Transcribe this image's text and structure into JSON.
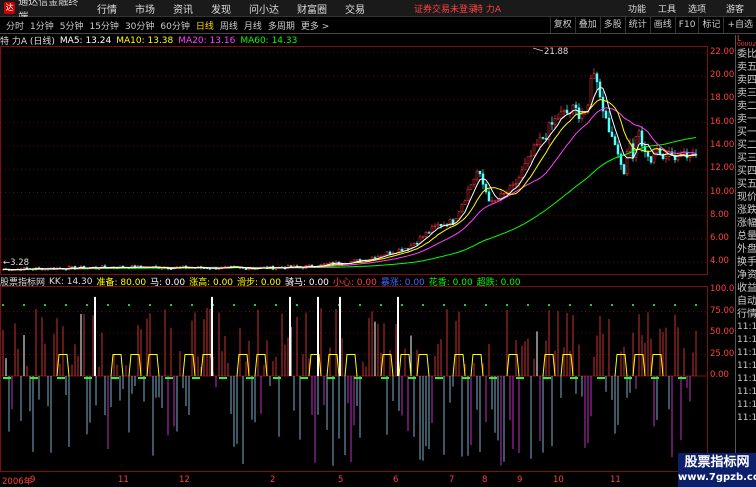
{
  "menubar": {
    "app_title": "通达信金融终端",
    "menu_items": [
      "行情",
      "市场",
      "资讯",
      "发现",
      "问小达",
      "财富圈",
      "交易"
    ],
    "notice": "证券交易未登录",
    "stock_name": "特 力A",
    "right_items": [
      "功能",
      "工具",
      "选项"
    ],
    "guest": "游客"
  },
  "toolbar": {
    "periods": [
      "分时",
      "1分钟",
      "5分钟",
      "15分钟",
      "30分钟",
      "60分钟",
      "日线",
      "周线",
      "月线",
      "多周期",
      "更多 >"
    ],
    "active_period": "日线",
    "tools": [
      "复权",
      "叠加",
      "多股",
      "统计",
      "画线",
      "F10",
      "标记",
      "+自选"
    ]
  },
  "main_header": {
    "title": "特 力A (日线)",
    "ma5": "MA5: 13.24",
    "ma10": "MA10: 13.38",
    "ma20": "MA20: 13.16",
    "ma60": "MA60: 14.33",
    "colors": {
      "ma5": "#ffffff",
      "ma10": "#ffff00",
      "ma20": "#ff40ff",
      "ma60": "#00ff00"
    }
  },
  "price_axis": [
    "22.00",
    "20.00",
    "18.00",
    "16.00",
    "14.00",
    "12.00",
    "10.00",
    "8.00",
    "6.00",
    "4.00"
  ],
  "annotations": {
    "high": "21.88",
    "low": "3.28"
  },
  "indicator_header": {
    "name": "股票指标网",
    "kk": "KK: 14.30",
    "items": [
      {
        "label": "准备:",
        "value": "80.00",
        "color": "#ffff00"
      },
      {
        "label": "马:",
        "value": "0.00",
        "color": "#ffffff"
      },
      {
        "label": "涨高:",
        "value": "0.00",
        "color": "#ffff00"
      },
      {
        "label": "滑步:",
        "value": "0.00",
        "color": "#ffff00"
      },
      {
        "label": "骑马:",
        "value": "0.00",
        "color": "#ffffff"
      },
      {
        "label": "小心:",
        "value": "0.00",
        "color": "#ff4040"
      },
      {
        "label": "暴涨:",
        "value": "0.00",
        "color": "#4466ff"
      },
      {
        "label": "花香:",
        "value": "0.00",
        "color": "#00ff00"
      },
      {
        "label": "超跌:",
        "value": "0.00",
        "color": "#00ff00"
      }
    ]
  },
  "indicator_axis": [
    "100.0",
    "75.00",
    "50.00",
    "25.00",
    "0.00"
  ],
  "dates": [
    "2006年",
    "9",
    "11",
    "12",
    "2",
    "5",
    "6",
    "7",
    "8",
    "9",
    "10",
    "11"
  ],
  "side_panel": [
    {
      "text": "委比",
      "color": "normal"
    },
    {
      "text": "卖五",
      "color": "normal"
    },
    {
      "text": "卖四",
      "color": "normal"
    },
    {
      "text": "卖三",
      "color": "normal"
    },
    {
      "text": "卖二",
      "color": "normal"
    },
    {
      "text": "卖一",
      "color": "normal"
    },
    {
      "text": "买一",
      "color": "normal"
    },
    {
      "text": "买二",
      "color": "normal"
    },
    {
      "text": "买三",
      "color": "normal"
    },
    {
      "text": "买四",
      "color": "normal"
    },
    {
      "text": "买五",
      "color": "normal"
    },
    {
      "text": "现价",
      "color": "normal"
    },
    {
      "text": "涨跌",
      "color": "normal"
    },
    {
      "text": "涨幅",
      "color": "normal"
    },
    {
      "text": "总量",
      "color": "normal"
    },
    {
      "text": "外盘",
      "color": "normal"
    },
    {
      "text": "换手",
      "color": "normal"
    },
    {
      "text": "净资",
      "color": "normal"
    },
    {
      "text": "收益",
      "color": "normal"
    },
    {
      "text": "自动",
      "color": "normal"
    },
    {
      "text": "行情",
      "color": "normal"
    },
    {
      "text": "11:1",
      "color": "normal"
    },
    {
      "text": "11:1",
      "color": "normal"
    },
    {
      "text": "11:1",
      "color": "normal"
    },
    {
      "text": "11:1",
      "color": "normal"
    },
    {
      "text": "11:1",
      "color": "normal"
    },
    {
      "text": "11:1",
      "color": "normal"
    },
    {
      "text": "11:1",
      "color": "normal"
    },
    {
      "text": "11:1",
      "color": "normal"
    }
  ],
  "side_top": {
    "l": "L",
    "code": "000025"
  },
  "watermark": {
    "line1": "股票指标网",
    "line2": "www.7gpzb.com"
  }
}
